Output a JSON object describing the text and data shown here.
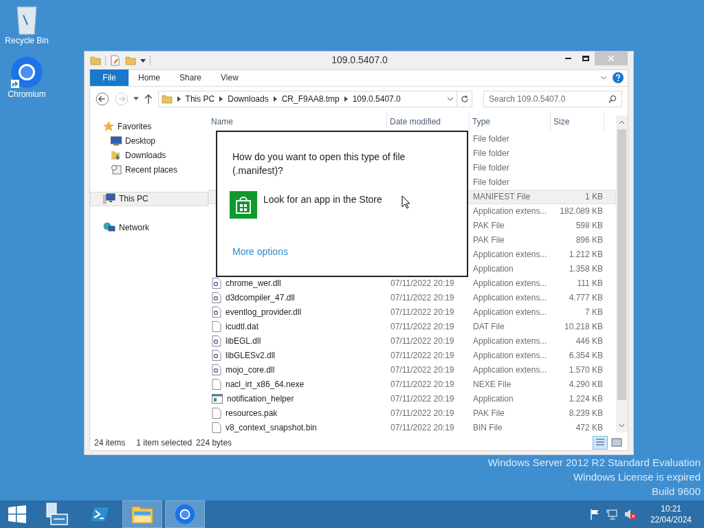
{
  "desktop_icons": [
    {
      "label": "Recycle Bin",
      "kind": "bin"
    },
    {
      "label": "Chromium",
      "kind": "chromium"
    }
  ],
  "window": {
    "title": "109.0.5407.0",
    "ribbon_tabs": [
      {
        "label": "File",
        "selected": true
      },
      {
        "label": "Home",
        "selected": false
      },
      {
        "label": "Share",
        "selected": false
      },
      {
        "label": "View",
        "selected": false
      }
    ]
  },
  "address": {
    "crumbs": [
      "This PC",
      "Downloads",
      "CR_F9AA8.tmp",
      "109.0.5407.0"
    ],
    "search_placeholder": "Search 109.0.5407.0"
  },
  "nav": [
    {
      "label": "Favorites",
      "kind": "star",
      "selected": false,
      "children": [
        {
          "label": "Desktop",
          "kind": "desktop",
          "selected": false
        },
        {
          "label": "Downloads",
          "kind": "downloads",
          "selected": false
        },
        {
          "label": "Recent places",
          "kind": "recent",
          "selected": false
        }
      ]
    },
    {
      "label": "This PC",
      "kind": "pc",
      "selected": true
    },
    {
      "label": "Network",
      "kind": "network",
      "selected": false
    }
  ],
  "columns": [
    "Name",
    "Date modified",
    "Type",
    "Size"
  ],
  "rows": [
    {
      "type": "File folder",
      "selected": false
    },
    {
      "type": "File folder",
      "selected": false
    },
    {
      "type": "File folder",
      "selected": false
    },
    {
      "type": "File folder",
      "selected": false
    },
    {
      "type": "MANIFEST File",
      "size": "1 KB",
      "selected": true
    },
    {
      "type": "Application extens...",
      "size": "182.089 KB",
      "selected": false
    },
    {
      "type": "PAK File",
      "size": "598 KB",
      "selected": false
    },
    {
      "type": "PAK File",
      "size": "896 KB",
      "selected": false
    },
    {
      "type": "Application extens...",
      "size": "1.212 KB",
      "selected": false
    },
    {
      "type": "Application",
      "size": "1.358 KB",
      "selected": false
    },
    {
      "kind": "dll",
      "name": "chrome_wer.dll",
      "date": "07/11/2022 20:19",
      "type": "Application extens...",
      "size": "111 KB",
      "selected": false
    },
    {
      "kind": "dll",
      "name": "d3dcompiler_47.dll",
      "date": "07/11/2022 20:19",
      "type": "Application extens...",
      "size": "4.777 KB",
      "selected": false
    },
    {
      "kind": "dll",
      "name": "eventlog_provider.dll",
      "date": "07/11/2022 20:19",
      "type": "Application extens...",
      "size": "7 KB",
      "selected": false
    },
    {
      "kind": "file",
      "name": "icudtl.dat",
      "date": "07/11/2022 20:19",
      "type": "DAT File",
      "size": "10.218 KB",
      "selected": false
    },
    {
      "kind": "dll",
      "name": "libEGL.dll",
      "date": "07/11/2022 20:19",
      "type": "Application extens...",
      "size": "446 KB",
      "selected": false
    },
    {
      "kind": "dll",
      "name": "libGLESv2.dll",
      "date": "07/11/2022 20:19",
      "type": "Application extens...",
      "size": "6.354 KB",
      "selected": false
    },
    {
      "kind": "dll",
      "name": "mojo_core.dll",
      "date": "07/11/2022 20:19",
      "type": "Application extens...",
      "size": "1.570 KB",
      "selected": false
    },
    {
      "kind": "file",
      "name": "nacl_irt_x86_64.nexe",
      "date": "07/11/2022 20:19",
      "type": "NEXE File",
      "size": "4.290 KB",
      "selected": false
    },
    {
      "kind": "app",
      "name": "notification_helper",
      "date": "07/11/2022 20:19",
      "type": "Application",
      "size": "1.224 KB",
      "selected": false
    },
    {
      "kind": "file",
      "name": "resources.pak",
      "date": "07/11/2022 20:19",
      "type": "PAK File",
      "size": "8.239 KB",
      "selected": false
    },
    {
      "kind": "file",
      "name": "v8_context_snapshot.bin",
      "date": "07/11/2022 20:19",
      "type": "BIN File",
      "size": "472 KB",
      "selected": false
    }
  ],
  "status": {
    "count": "24 items",
    "selection": "1 item selected",
    "size": "224 bytes"
  },
  "dialog": {
    "question": "How do you want to open this type of file (.manifest)?",
    "option": "Look for an app in the Store",
    "link": "More options"
  },
  "desktop_text": [
    "Windows Server 2012 R2 Standard Evaluation",
    "Windows License is expired",
    "Build 9600"
  ],
  "taskbar": {
    "apps": [
      {
        "kind": "server",
        "active": false
      },
      {
        "kind": "powershell",
        "active": false
      },
      {
        "kind": "explorer",
        "active": true
      },
      {
        "kind": "chromium",
        "active": true
      }
    ],
    "time": "10:21",
    "date": "22/04/2024"
  }
}
